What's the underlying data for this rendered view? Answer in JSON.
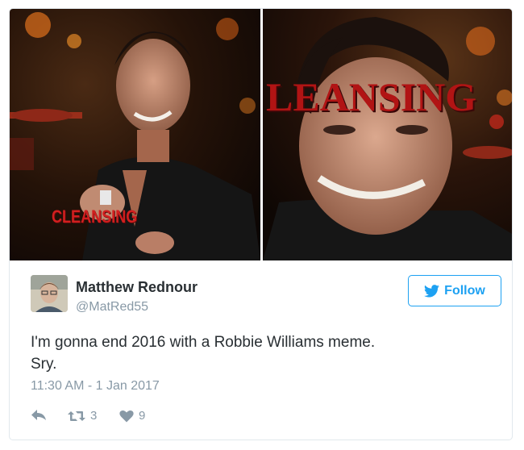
{
  "media": {
    "left_caption": "CLEANSING",
    "right_caption": "LEANSING"
  },
  "author": {
    "display_name": "Matthew Rednour",
    "handle": "@MatRed55"
  },
  "follow": {
    "label": "Follow",
    "icon": "twitter-bird-icon"
  },
  "tweet": {
    "lines": [
      "I'm gonna end 2016 with a Robbie Williams meme.",
      "Sry."
    ],
    "timestamp": "11:30 AM - 1 Jan 2017"
  },
  "stats": {
    "retweets": "3",
    "likes": "9"
  },
  "colors": {
    "accent": "#1da1f2",
    "muted": "#8899a6",
    "text": "#292f33",
    "border": "#e1e8ed"
  }
}
